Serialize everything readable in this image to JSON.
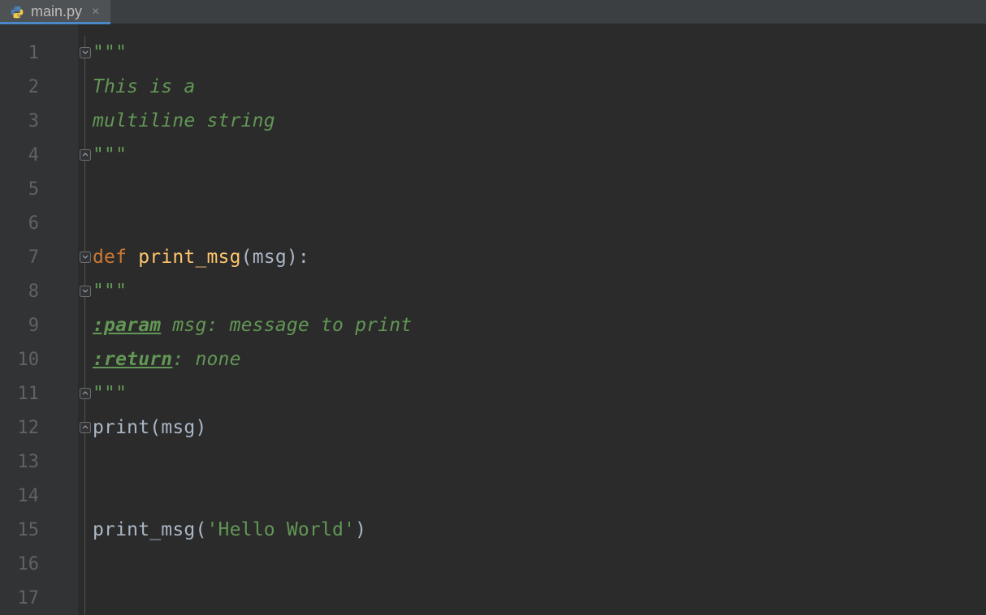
{
  "tab": {
    "filename": "main.py"
  },
  "gutter": {
    "first": 1,
    "last": 17
  },
  "fold_markers": {
    "l1": "open-down",
    "l4": "close-up",
    "l7": "open-down",
    "l8": "open-down",
    "l11": "close-up",
    "l12": "close-up"
  },
  "code": {
    "l1": {
      "t1": "\"\"\""
    },
    "l2": {
      "t1": "This is a"
    },
    "l3": {
      "t1": "multiline string"
    },
    "l4": {
      "t1": "\"\"\""
    },
    "l5": {},
    "l6": {},
    "l7": {
      "kw": "def",
      "sp1": " ",
      "fn": "print_msg",
      "p1": "(",
      "arg": "msg",
      "p2": "):"
    },
    "l8": {
      "t1": "\"\"\""
    },
    "l9": {
      "tag": ":param",
      "rest": " msg: message to print"
    },
    "l10": {
      "tag": ":return",
      "colon": ":",
      "rest": " none"
    },
    "l11": {
      "t1": "\"\"\""
    },
    "l12": {
      "call": "print",
      "p1": "(",
      "arg": "msg",
      "p2": ")"
    },
    "l13": {},
    "l14": {},
    "l15": {
      "call": "print_msg",
      "p1": "(",
      "str": "'Hello World'",
      "p2": ")"
    },
    "l16": {},
    "l17": {}
  }
}
